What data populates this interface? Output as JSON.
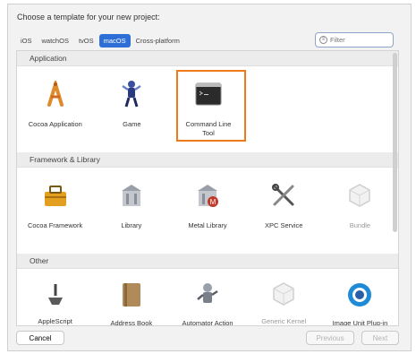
{
  "window": {
    "heading": "Choose a template for your new project:"
  },
  "platform_tabs": [
    {
      "label": "iOS",
      "active": false
    },
    {
      "label": "watchOS",
      "active": false
    },
    {
      "label": "tvOS",
      "active": false
    },
    {
      "label": "macOS",
      "active": true
    },
    {
      "label": "Cross-platform",
      "active": false
    }
  ],
  "filter": {
    "placeholder": "Filter",
    "value": ""
  },
  "sections": {
    "application": {
      "title": "Application",
      "items": [
        {
          "label": "Cocoa Application",
          "icon": "cocoa-app-icon"
        },
        {
          "label": "Game",
          "icon": "game-icon"
        },
        {
          "label": "Command Line Tool",
          "icon": "terminal-icon",
          "selected": true
        }
      ]
    },
    "framework": {
      "title": "Framework & Library",
      "items": [
        {
          "label": "Cocoa Framework",
          "icon": "toolbox-icon"
        },
        {
          "label": "Library",
          "icon": "library-building-icon"
        },
        {
          "label": "Metal Library",
          "icon": "metal-library-icon"
        },
        {
          "label": "XPC Service",
          "icon": "tools-icon"
        },
        {
          "label": "Bundle",
          "icon": "bundle-icon"
        }
      ]
    },
    "other": {
      "title": "Other",
      "items": [
        {
          "label": "AppleScript",
          "icon": "applescript-icon"
        },
        {
          "label": "Address Book",
          "icon": "address-book-icon"
        },
        {
          "label": "Automator Action",
          "icon": "automator-icon"
        },
        {
          "label": "Generic Kernel",
          "icon": "kernel-extension-icon"
        },
        {
          "label": "Image Unit Plug-in",
          "icon": "image-unit-icon"
        }
      ]
    }
  },
  "buttons": {
    "cancel": "Cancel",
    "previous": "Previous",
    "next": "Next"
  },
  "colors": {
    "accent": "#2d6fd6",
    "selection": "#f07a1a"
  }
}
